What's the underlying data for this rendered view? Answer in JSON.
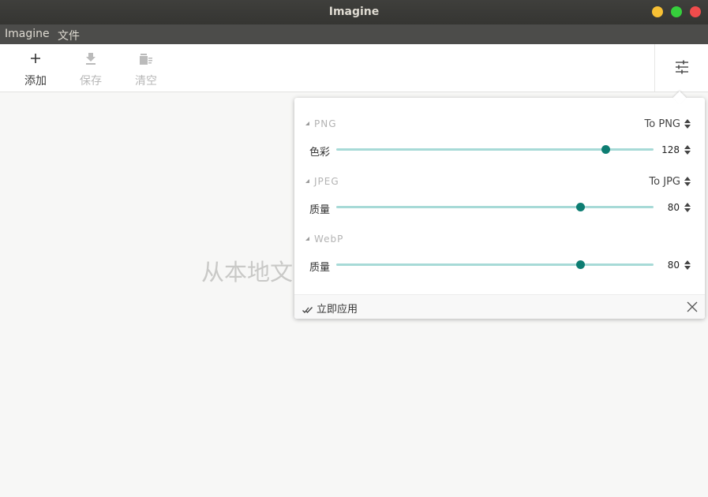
{
  "window": {
    "title": "Imagine"
  },
  "menu": {
    "items": [
      "Imagine",
      "文件"
    ]
  },
  "toolbar": {
    "add_label": "添加",
    "save_label": "保存",
    "clear_label": "清空"
  },
  "main": {
    "drop_hint": "从本地文"
  },
  "settings": {
    "png": {
      "header": "PNG",
      "format": "To PNG",
      "param_label": "色彩",
      "value": "128",
      "slider_fraction": 0.85
    },
    "jpeg": {
      "header": "JPEG",
      "format": "To JPG",
      "param_label": "质量",
      "value": "80",
      "slider_fraction": 0.77
    },
    "webp": {
      "header": "WebP",
      "param_label": "质量",
      "value": "80",
      "slider_fraction": 0.77
    },
    "apply_label": "立即应用"
  },
  "colors": {
    "accent": "#0d7d72",
    "track": "#a7dad7"
  },
  "icons": [
    "plus-icon",
    "download-icon",
    "trash-icon",
    "sliders-icon",
    "double-check-icon",
    "close-icon"
  ]
}
